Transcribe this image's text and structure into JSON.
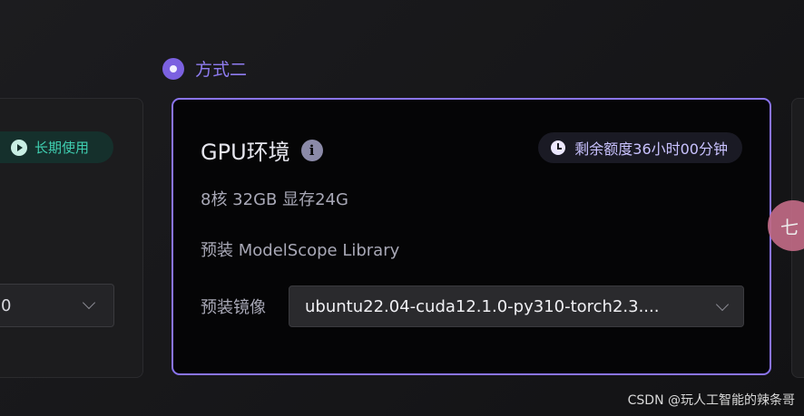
{
  "option_radio": {
    "label": "方式二"
  },
  "left_card": {
    "badge": "长期使用",
    "select_value": "0"
  },
  "gpu_card": {
    "title": "GPU环境",
    "quota": "剩余额度36小时00分钟",
    "specs": "8核 32GB 显存24G",
    "preinstall": "预装 ModelScope Library",
    "image_label": "预装镜像",
    "image_value": "ubuntu22.04-cuda12.1.0-py310-torch2.3...."
  },
  "floating_button": {
    "text": "七"
  },
  "watermark": "CSDN @玩人工智能的辣条哥",
  "colors": {
    "accent": "#8a74ee",
    "badge_green": "#3fcfb1",
    "badge_bg": "#15302c"
  }
}
